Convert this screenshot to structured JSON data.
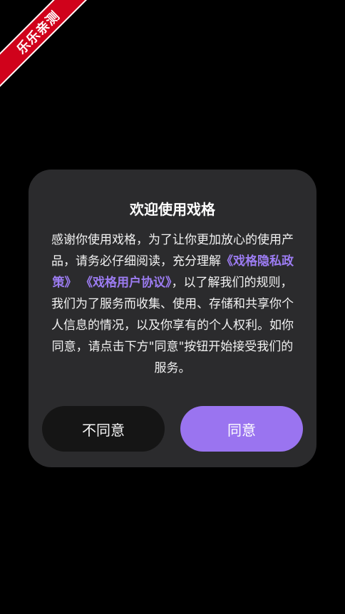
{
  "watermark": {
    "text": "乐乐亲测"
  },
  "dialog": {
    "title": "欢迎使用戏格",
    "body_before": "感谢你使用戏格，为了让你更加放心的使用产品，请务必仔细阅读，充分理解",
    "privacy_link": "《戏格隐私政策》",
    "agreement_link": "《戏格用户协议》",
    "body_after": "，以了解我们的规则，我们为了服务而收集、使用、存储和共享你个人信息的情况，以及你享有的个人权利。如你同意，请点击下方\"同意\"按钮开始接受我们的服务。",
    "disagree_label": "不同意",
    "agree_label": "同意"
  },
  "colors": {
    "accent": "#9a74f0",
    "link": "#9c7cf2",
    "dialog_bg": "#2b2b2d",
    "ribbon": "#d0021b"
  }
}
